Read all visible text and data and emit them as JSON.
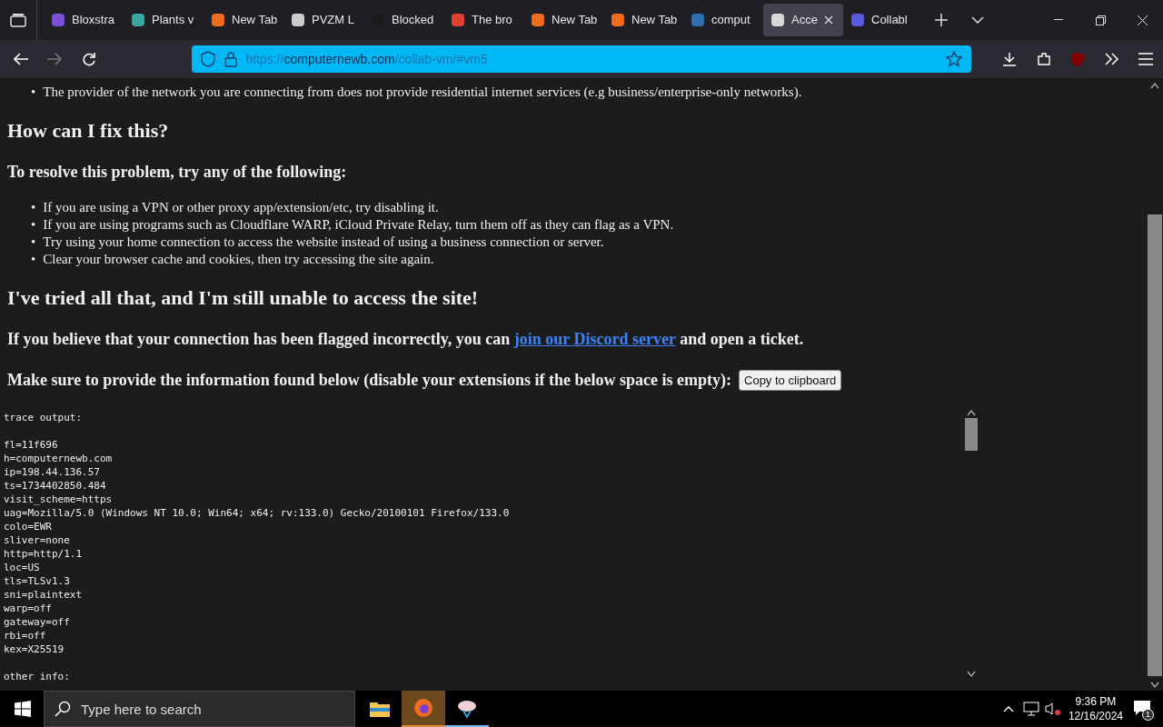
{
  "tabs": [
    {
      "label": "Bloxstra",
      "selected": false,
      "color": "#7b4fd6"
    },
    {
      "label": "Plants v",
      "selected": false,
      "color": "#3aa6a0"
    },
    {
      "label": "New Tab",
      "selected": false,
      "color": "#f26b1d"
    },
    {
      "label": "PVZM L",
      "selected": false,
      "color": "#cccccc"
    },
    {
      "label": "Blocked",
      "selected": false,
      "color": "#1a1a1a"
    },
    {
      "label": "The bro",
      "selected": false,
      "color": "#e2412d"
    },
    {
      "label": "New Tab",
      "selected": false,
      "color": "#f26b1d"
    },
    {
      "label": "New Tab",
      "selected": false,
      "color": "#f26b1d"
    },
    {
      "label": "comput",
      "selected": false,
      "color": "#2f6fb0"
    },
    {
      "label": "Acce",
      "selected": true,
      "color": "#d8d8d8"
    },
    {
      "label": "Collabl",
      "selected": false,
      "color": "#5a5ae0"
    }
  ],
  "address_bar": {
    "host": "computernewb.com",
    "scheme": "https://",
    "path": "/collab-vm/#vm5"
  },
  "content": {
    "top_bullets": [
      {
        "marker": "•",
        "text": "The provider of the network you are connecting from does not provide residential internet services (e.g business/enterprise-only networks)."
      }
    ],
    "heading_1": "How can I fix this?",
    "subheading": "To resolve this problem, try any of the following:",
    "fix_bullets": [
      {
        "marker": "•",
        "text": "If you are using a VPN or other proxy app/extension/etc, try disabling it."
      },
      {
        "marker": "•",
        "text": "If you are using programs such as Cloudflare WARP, iCloud Private Relay, turn them off as they can flag as a VPN."
      },
      {
        "marker": "•",
        "text": "Try using your home connection to access the website instead of using a business connection or server."
      },
      {
        "marker": "•",
        "text": "Clear your browser cache and cookies, then try accessing the site again."
      }
    ],
    "heading_2": "I've tried all that, and I'm still unable to access the site!",
    "discord_line": {
      "before": "If you believe that your connection has been flagged incorrectly, you can",
      "link": "join our Discord server",
      "after": "and open a ticket."
    },
    "provide_line": "Make sure to provide the information found below (disable your extensions if the below space is empty):",
    "copy_button": "Copy to clipboard",
    "trace_header": "trace output:",
    "trace_lines": [
      "fl=11f696",
      "h=computernewb.com",
      "ip=198.44.136.57",
      "ts=1734402850.484",
      "visit_scheme=https",
      "uag=Mozilla/5.0 (Windows NT 10.0; Win64; x64; rv:133.0) Gecko/20100101 Firefox/133.0",
      "colo=EWR",
      "sliver=none",
      "http=http/1.1",
      "loc=US",
      "tls=TLSv1.3",
      "sni=plaintext",
      "warp=off",
      "gateway=off",
      "rbi=off",
      "kex=X25519"
    ],
    "other_info": "other info:"
  },
  "taskbar": {
    "search_placeholder": "Type here to search",
    "time": "9:36 PM",
    "date": "12/16/2024",
    "notification_count": "1"
  }
}
